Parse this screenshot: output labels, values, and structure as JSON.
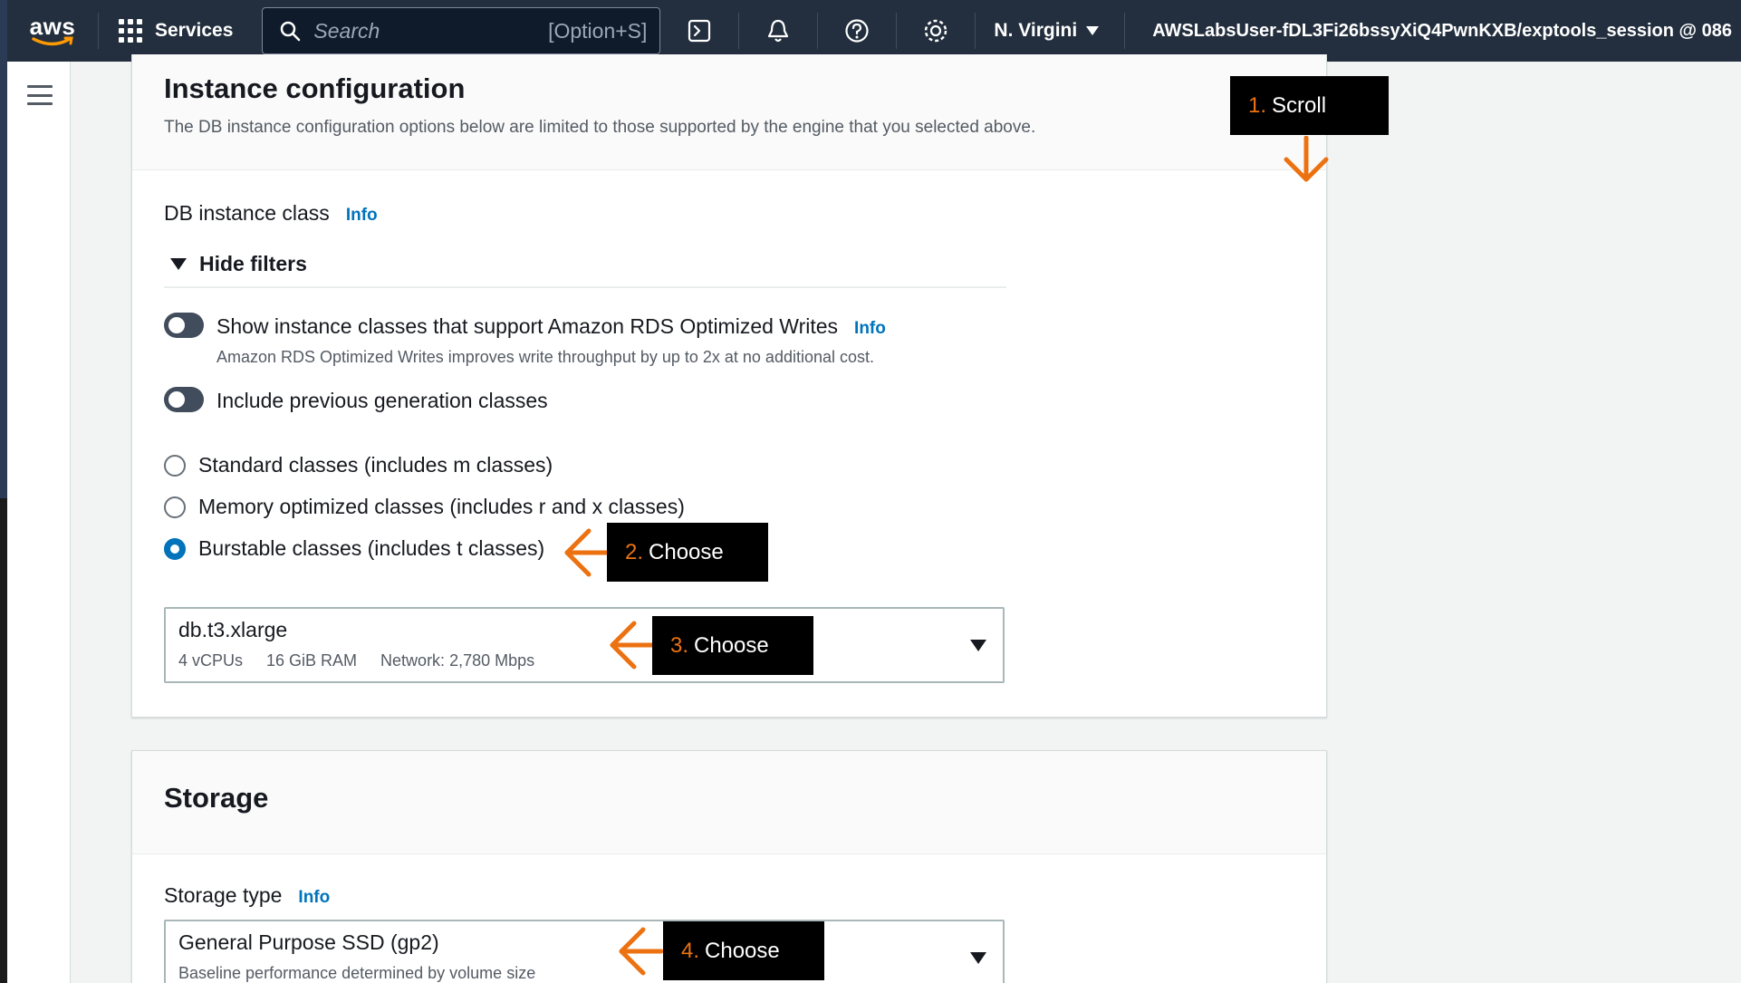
{
  "topnav": {
    "logo_text": "aws",
    "services_label": "Services",
    "search_placeholder": "Search",
    "search_shortcut": "[Option+S]",
    "region_label": "N. Virgini",
    "account_label": "AWSLabsUser-fDL3Fi26bssyXiQ4PwnKXB/exptools_session @ 086"
  },
  "instance_config": {
    "title": "Instance configuration",
    "description": "The DB instance configuration options below are limited to those supported by the engine that you selected above.",
    "db_class_label": "DB instance class",
    "info_label": "Info",
    "hide_filters_label": "Hide filters",
    "toggle_optimized_writes": {
      "label": "Show instance classes that support Amazon RDS Optimized Writes",
      "info": "Info",
      "sublabel": "Amazon RDS Optimized Writes improves write throughput by up to 2x at no additional cost."
    },
    "toggle_previous_gen": {
      "label": "Include previous generation classes"
    },
    "radio_options": [
      {
        "label": "Standard classes (includes m classes)",
        "checked": false
      },
      {
        "label": "Memory optimized classes (includes r and x classes)",
        "checked": false
      },
      {
        "label": "Burstable classes (includes t classes)",
        "checked": true
      }
    ],
    "instance_select": {
      "value": "db.t3.xlarge",
      "vcpus": "4 vCPUs",
      "ram": "16 GiB RAM",
      "network": "Network: 2,780 Mbps"
    }
  },
  "storage": {
    "title": "Storage",
    "storage_type_label": "Storage type",
    "info_label": "Info",
    "storage_select": {
      "value": "General Purpose SSD (gp2)",
      "sublabel": "Baseline performance determined by volume size"
    }
  },
  "annotations": [
    {
      "num": "1.",
      "text": "Scroll"
    },
    {
      "num": "2.",
      "text": "Choose"
    },
    {
      "num": "3.",
      "text": "Choose"
    },
    {
      "num": "4.",
      "text": "Choose"
    }
  ],
  "colors": {
    "nav_bg": "#232f3e",
    "accent_blue": "#0073bb",
    "annotation_orange": "#ec7211",
    "annotation_bg": "#000000"
  }
}
